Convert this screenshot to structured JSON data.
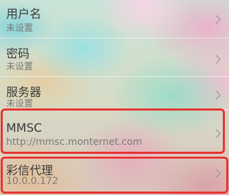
{
  "settings": {
    "items": [
      {
        "label": "用户名",
        "value": "未设置"
      },
      {
        "label": "密码",
        "value": "未设置"
      },
      {
        "label": "服务器",
        "value": "未设置"
      },
      {
        "label": "MMSC",
        "value": "http://mmsc.monternet.com"
      },
      {
        "label": "彩信代理",
        "value": "10.0.0.172"
      }
    ]
  },
  "colors": {
    "highlight_border": "#e8322f",
    "label_text": "#3a3a3a",
    "value_text": "#7a7a7a"
  },
  "icons": {
    "row_arrow": "chevron-right-icon"
  }
}
